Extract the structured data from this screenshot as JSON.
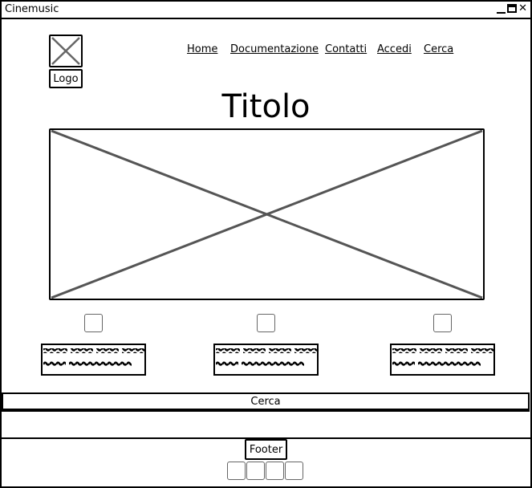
{
  "window": {
    "title": "Cinemusic"
  },
  "header": {
    "logo_label": "Logo",
    "nav": [
      "Home",
      "Documentazione",
      "Contatti",
      "Accedi",
      "Cerca"
    ]
  },
  "main": {
    "title": "Titolo"
  },
  "search_bar": {
    "label": "Cerca"
  },
  "footer": {
    "label": "Footer"
  }
}
